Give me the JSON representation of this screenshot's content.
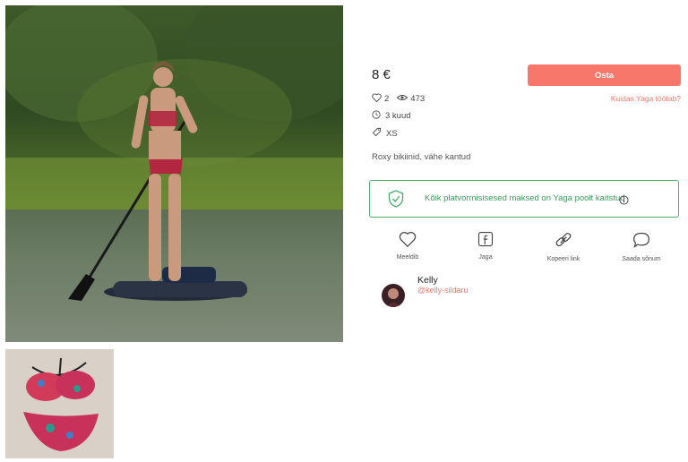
{
  "listing": {
    "price": "8 €",
    "buy_label": "Osta",
    "how_link": "Kuidas Yaga töötab?",
    "likes": "2",
    "views": "473",
    "age": "3 kuud",
    "size": "XS",
    "description": "Roxy bikiinid, vähe kantud",
    "protection_text": "Kõik platvormisisesed maksed on Yaga poolt kaitstud"
  },
  "actions": [
    {
      "label": "Meeldib",
      "icon": "heart-icon"
    },
    {
      "label": "Jaga",
      "icon": "facebook-icon"
    },
    {
      "label": "Kopeeri link",
      "icon": "link-icon"
    },
    {
      "label": "Saada sõnum",
      "icon": "chat-icon"
    }
  ],
  "seller": {
    "name": "Kelly",
    "handle": "@kelly-sildaru"
  },
  "colors": {
    "accent": "#f7776a",
    "protect_green": "#4caf6e"
  }
}
